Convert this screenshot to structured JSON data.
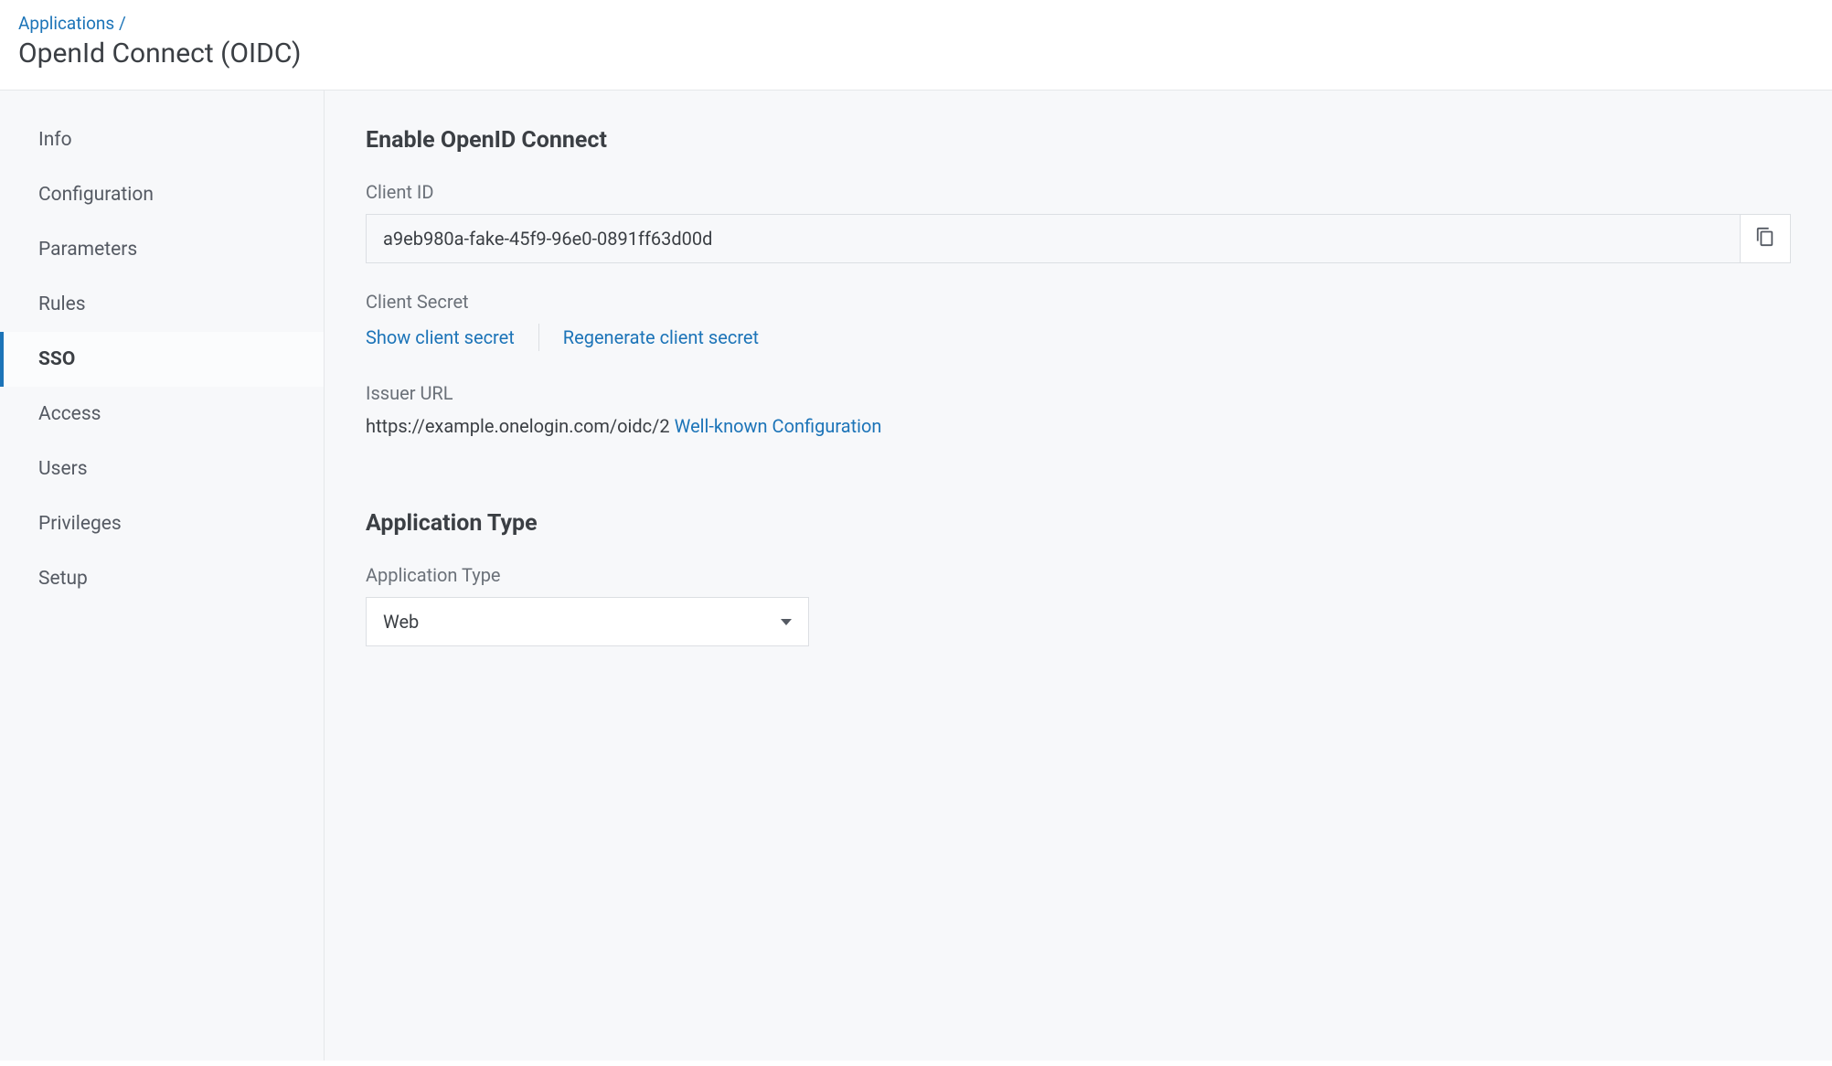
{
  "breadcrumb": {
    "parent": "Applications",
    "separator": "/"
  },
  "page_title": "OpenId Connect (OIDC)",
  "sidebar": {
    "items": [
      {
        "label": "Info",
        "active": false
      },
      {
        "label": "Configuration",
        "active": false
      },
      {
        "label": "Parameters",
        "active": false
      },
      {
        "label": "Rules",
        "active": false
      },
      {
        "label": "SSO",
        "active": true
      },
      {
        "label": "Access",
        "active": false
      },
      {
        "label": "Users",
        "active": false
      },
      {
        "label": "Privileges",
        "active": false
      },
      {
        "label": "Setup",
        "active": false
      }
    ]
  },
  "main": {
    "section1_title": "Enable OpenID Connect",
    "client_id_label": "Client ID",
    "client_id_value": "a9eb980a-fake-45f9-96e0-0891ff63d00d",
    "client_secret_label": "Client Secret",
    "show_secret_link": "Show client secret",
    "regen_secret_link": "Regenerate client secret",
    "issuer_label": "Issuer URL",
    "issuer_url": "https://example.onelogin.com/oidc/2",
    "wellknown_link": "Well-known Configuration",
    "section2_title": "Application Type",
    "app_type_label": "Application Type",
    "app_type_value": "Web"
  }
}
